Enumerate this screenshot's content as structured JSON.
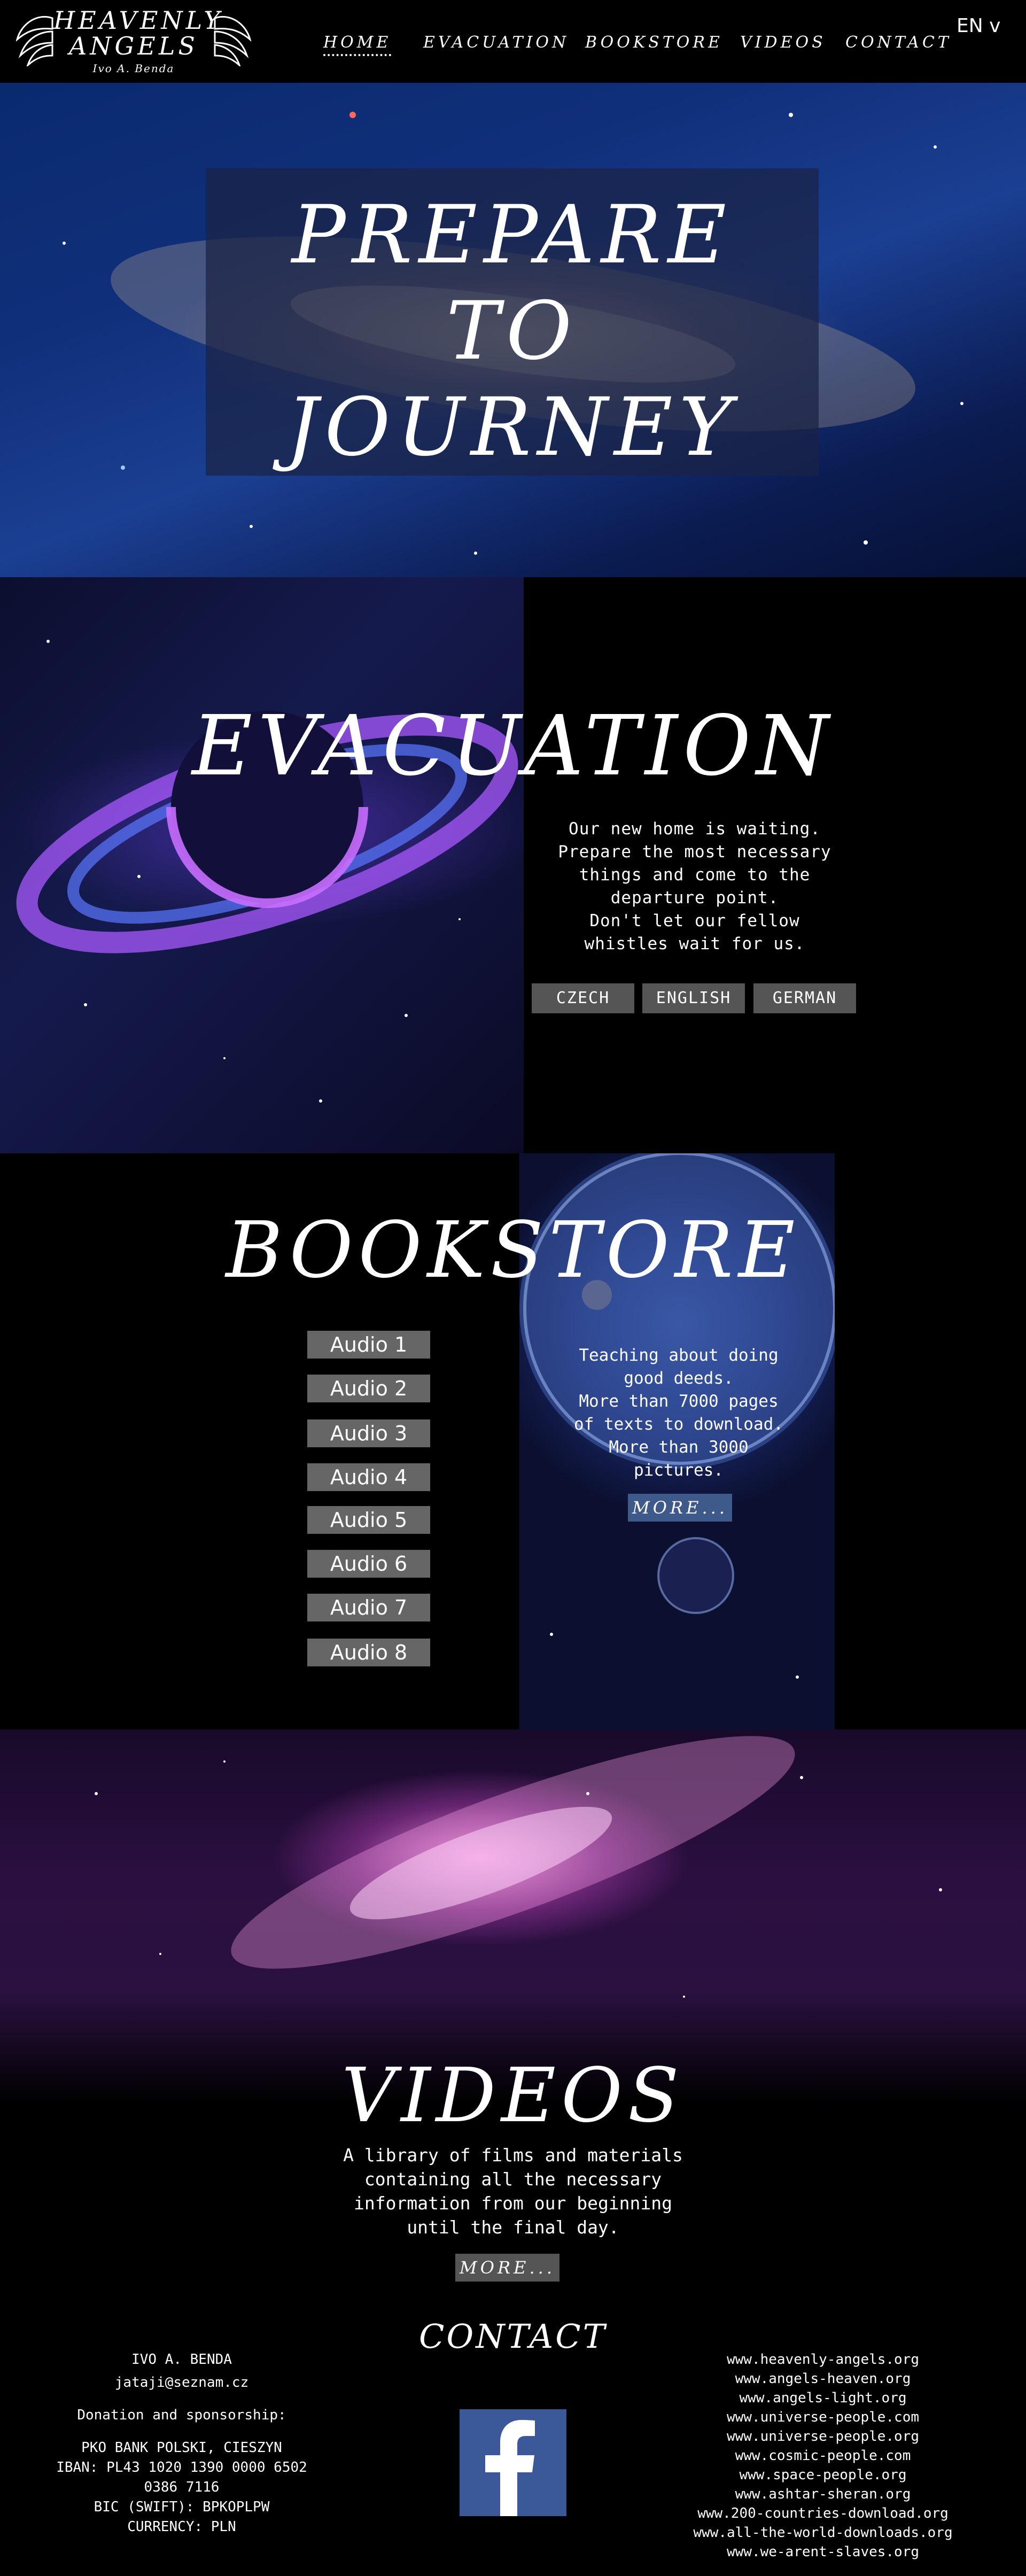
{
  "header": {
    "logo_line1": "HEAVENLY",
    "logo_line2": "ANGELS",
    "logo_author": "Ivo A. Benda",
    "nav": [
      {
        "label": "HOME",
        "active": true
      },
      {
        "label": "EVACUATION"
      },
      {
        "label": "BOOKSTORE"
      },
      {
        "label": "VIDEOS"
      },
      {
        "label": "CONTACT"
      }
    ],
    "language": "EN",
    "language_chevron": "v"
  },
  "hero": {
    "line1": "PREPARE",
    "line2": "TO",
    "line3": "JOURNEY"
  },
  "evacuation": {
    "heading": "EVACUATION",
    "text": [
      "Our new home is waiting.",
      "Prepare the most necessary",
      "things and come to the",
      "departure point.",
      "Don't let our fellow",
      "whistles wait for us."
    ],
    "buttons": [
      "CZECH",
      "ENGLISH",
      "GERMAN"
    ]
  },
  "bookstore": {
    "heading": "BOOKSTORE",
    "audio": [
      "Audio 1",
      "Audio 2",
      "Audio 3",
      "Audio 4",
      "Audio 5",
      "Audio 6",
      "Audio 7",
      "Audio 8"
    ],
    "text": [
      "Teaching about doing",
      "good deeds.",
      "More than 7000 pages",
      "of texts to download.",
      "More than 3000",
      "pictures."
    ],
    "more": "MORE..."
  },
  "videos": {
    "heading": "VIDEOS",
    "text": [
      "A library of films and materials",
      "containing all the necessary",
      "information from our beginning",
      "until the final day."
    ],
    "more": "MORE..."
  },
  "contact": {
    "heading": "CONTACT",
    "name": "IVO A. BENDA",
    "email": "jataji@seznam.cz",
    "donation": "Donation and sponsorship:",
    "bank": "PKO BANK POLSKI, CIESZYN",
    "iban": "IBAN: PL43 1020 1390 0000 6502",
    "iban2": "0386 7116",
    "bic": "BIC (SWIFT): BPKOPLPW",
    "currency": "CURRENCY: PLN",
    "social_icon": "facebook-icon",
    "links": [
      "www.heavenly-angels.org",
      "www.angels-heaven.org",
      "www.angels-light.org",
      "www.universe-people.com",
      "www.universe-people.org",
      "www.cosmic-people.com",
      "www.space-people.org",
      "www.ashtar-sheran.org",
      "www.200-countries-download.org",
      "www.all-the-world-downloads.org",
      "www.we-arent-slaves.org"
    ]
  },
  "colors": {
    "background": "#000000",
    "button_gray": "#555555",
    "more_blue": "#3d5a8a",
    "facebook": "#3b5998"
  }
}
